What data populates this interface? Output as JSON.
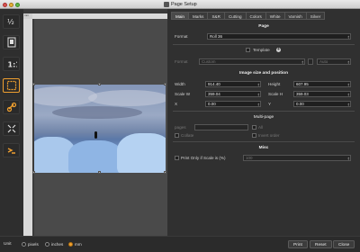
{
  "window": {
    "title": "Page Setup"
  },
  "tabs": [
    "Main",
    "Marks",
    "S&R",
    "Cutting",
    "Colors",
    "White",
    "Varnish",
    "Silver"
  ],
  "page": {
    "title": "Page",
    "format_label": "Format",
    "format_value": "Roll 36",
    "template_label": "Template",
    "template_format_label": "Format",
    "template_format_value": "Custom",
    "template_auto": "Auto"
  },
  "size": {
    "title": "Image size and position",
    "width_label": "Width",
    "width_value": "914.40",
    "height_label": "Height",
    "height_value": "607.95",
    "scale_w_label": "Scale W",
    "scale_w_value": "359.04",
    "scale_h_label": "Scale H",
    "scale_h_value": "359.03",
    "x_label": "X",
    "x_value": "0.00",
    "y_label": "Y",
    "y_value": "0.00"
  },
  "multipage": {
    "title": "Multi-page",
    "pages_label": "pages",
    "all_label": "All",
    "collate_label": "Collate",
    "invert_label": "Invert order"
  },
  "misc": {
    "title": "Misc",
    "print_only_label": "Print Only if Scale is (%)",
    "print_only_value": "100"
  },
  "ruler": {
    "corner": "mm",
    "bottom": "1080"
  },
  "units": {
    "label": "Unit",
    "options": [
      "pixels",
      "inches",
      "mm"
    ],
    "selected": "mm"
  },
  "buttons": {
    "print": "Print",
    "reset": "Reset",
    "close": "Close"
  },
  "colors": {
    "accent": "#f0a030",
    "toolbar_icon": "#f0a030",
    "background": "#2b2b2b"
  },
  "tools": [
    "page-size-icon",
    "page-fit-icon",
    "one-to-one-icon",
    "fit-frame-icon",
    "link-icon",
    "expand-icon",
    "print-mode-icon"
  ]
}
